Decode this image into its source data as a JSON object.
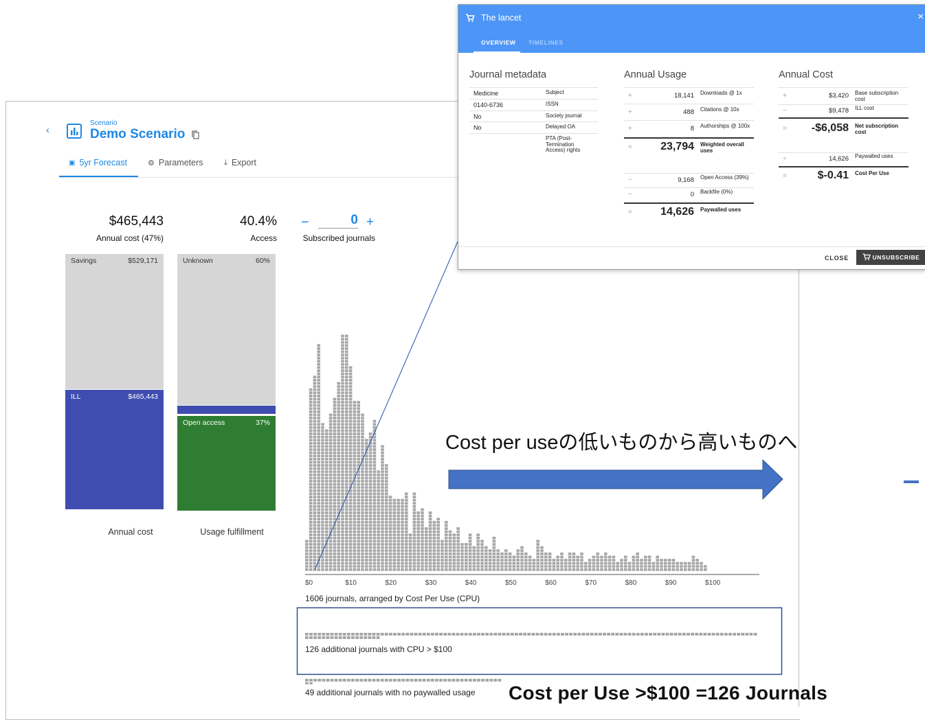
{
  "scenario": {
    "eyebrow": "Scenario",
    "title": "Demo Scenario",
    "tabs": [
      {
        "label": "5yr Forecast",
        "icon": "chart-icon",
        "active": true
      },
      {
        "label": "Parameters",
        "icon": "gear-icon"
      },
      {
        "label": "Export",
        "icon": "download-icon"
      }
    ]
  },
  "kpis": {
    "cost_value": "$465,443",
    "cost_label": "Annual cost (47%)",
    "access_value": "40.4%",
    "access_label": "Access",
    "subscribed_value": "0",
    "subscribed_label": "Subscribed journals",
    "minus": "−",
    "plus": "+"
  },
  "cost_bar": {
    "caption": "Annual cost",
    "segments": [
      {
        "name": "Savings",
        "value": "$529,171",
        "color": "#d6d6d6"
      },
      {
        "name": "ILL",
        "value": "$465,443",
        "color": "#3f4db0"
      }
    ]
  },
  "usage_bar": {
    "caption": "Usage fulfillment",
    "segments": [
      {
        "name": "Unknown",
        "value": "60%",
        "color": "#d6d6d6"
      },
      {
        "name": "",
        "value": "",
        "color": "#3f4db0"
      },
      {
        "name": "Open access",
        "value": "37%",
        "color": "#2e7d32"
      }
    ]
  },
  "chart_data": {
    "type": "bar",
    "x_ticks": [
      "$0",
      "$10",
      "$20",
      "$30",
      "$40",
      "$50",
      "$60",
      "$70",
      "$80",
      "$90",
      "$100"
    ],
    "xlim": [
      0,
      100
    ],
    "caption": "1606 journals, arranged by Cost Per Use (CPU)",
    "column_counts": [
      10,
      58,
      62,
      72,
      47,
      45,
      50,
      55,
      60,
      75,
      75,
      65,
      54,
      54,
      50,
      42,
      44,
      48,
      32,
      40,
      34,
      24,
      23,
      23,
      23,
      25,
      12,
      25,
      19,
      20,
      14,
      19,
      16,
      17,
      10,
      16,
      13,
      12,
      14,
      9,
      9,
      12,
      8,
      12,
      10,
      8,
      7,
      11,
      7,
      6,
      7,
      6,
      5,
      7,
      8,
      6,
      5,
      4,
      10,
      8,
      6,
      6,
      4,
      5,
      6,
      4,
      6,
      6,
      5,
      6,
      3,
      4,
      5,
      6,
      5,
      6,
      5,
      5,
      3,
      4,
      5,
      3,
      5,
      6,
      4,
      5,
      5,
      3,
      5,
      4,
      4,
      4,
      4,
      3,
      3,
      3,
      3,
      5,
      4,
      3,
      2
    ],
    "extra_groups": [
      {
        "label": "126 additional journals with CPU > $100",
        "count": 126
      },
      {
        "label": "49 additional journals with no paywalled usage",
        "count": 49
      }
    ]
  },
  "annotation": {
    "arrow_text": "Cost per useの低いものから高いものへ",
    "callout": "Cost per Use >$100 =126 Journals",
    "arrow_color": "#4472c4",
    "box_color": "#2f4b8f"
  },
  "modal": {
    "title": "The lancet",
    "tabs": [
      "OVERVIEW",
      "TIMELINES"
    ],
    "close_x": "×",
    "metadata": {
      "title": "Journal metadata",
      "rows": [
        {
          "value": "Medicine",
          "label": "Subject"
        },
        {
          "value": "0140-6736",
          "label": "ISSN"
        },
        {
          "value": "No",
          "label": "Society journal"
        },
        {
          "value": "No",
          "label": "Delayed OA"
        },
        {
          "value": "",
          "label": "PTA (Post-Termination Access) rights"
        }
      ]
    },
    "usage": {
      "title": "Annual Usage",
      "rows": [
        {
          "sign": "+",
          "value": "18,141",
          "label": "Downloads @ 1x"
        },
        {
          "sign": "+",
          "value": "488",
          "label": "Citations @ 10x"
        },
        {
          "sign": "+",
          "value": "8",
          "label": "Authorships @ 100x"
        },
        {
          "sign": "=",
          "value": "23,794",
          "label": "Weighted overall uses"
        },
        {
          "sign": "−",
          "value": "9,168",
          "label": "Open Access (39%)"
        },
        {
          "sign": "−",
          "value": "0",
          "label": "Backfile (0%)"
        },
        {
          "sign": "=",
          "value": "14,626",
          "label": "Paywalled uses"
        }
      ]
    },
    "cost": {
      "title": "Annual Cost",
      "rows": [
        {
          "sign": "+",
          "value": "$3,420",
          "label": "Base subscription cost"
        },
        {
          "sign": "−",
          "value": "$9,478",
          "label": "ILL cost"
        },
        {
          "sign": "=",
          "value": "-$6,058",
          "label": "Net subscription cost"
        },
        {
          "sign": "÷",
          "value": "14,626",
          "label": "Paywalled uses"
        },
        {
          "sign": "=",
          "value": "$-0.41",
          "label": "Cost Per Use"
        }
      ]
    },
    "close_label": "CLOSE",
    "unsubscribe_label": "UNSUBSCRIBE"
  }
}
